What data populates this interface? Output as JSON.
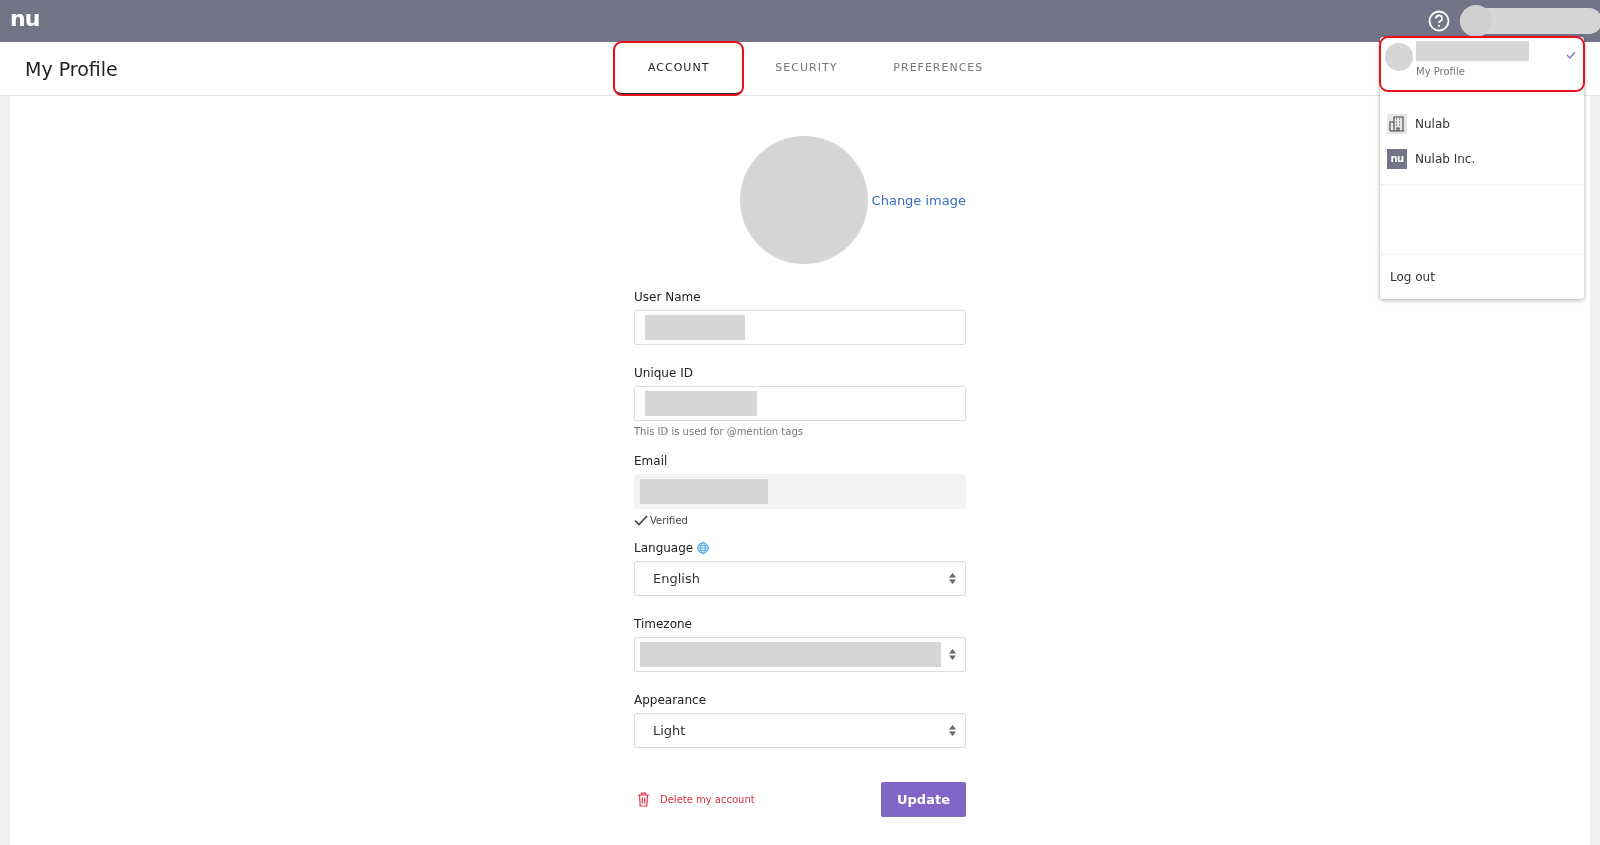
{
  "app_bar": {
    "logo_text": "nu"
  },
  "header": {
    "title": "My Profile"
  },
  "tabs": [
    {
      "label": "ACCOUNT",
      "selected": true,
      "highlighted": true
    },
    {
      "label": "SECURITY",
      "selected": false,
      "highlighted": false
    },
    {
      "label": "PREFERENCES",
      "selected": false,
      "highlighted": false
    }
  ],
  "profile_image": {
    "link": "Change image"
  },
  "fields": [
    {
      "kind": "text",
      "label": "User Name",
      "redacted": true
    },
    {
      "kind": "text",
      "label": "Unique ID",
      "redacted": true,
      "hint": "This ID is used for @mention tags"
    },
    {
      "kind": "readonly",
      "label": "Email",
      "redacted": true,
      "verified": true,
      "status": "Verified"
    },
    {
      "kind": "language_select",
      "label": "Language",
      "value": "English"
    },
    {
      "kind": "select",
      "label": "Timezone",
      "redacted": true
    },
    {
      "kind": "select",
      "label": "Appearance",
      "value": "Light"
    }
  ],
  "actions": {
    "delete": "Delete my account",
    "submit": "Update"
  },
  "account_menu": {
    "profile": {
      "subtitle": "My Profile",
      "checked": true,
      "highlighted": true
    },
    "organizations": [
      {
        "kind": "building",
        "name": "Nulab"
      },
      {
        "kind": "logo",
        "name": "Nulab Inc.",
        "logo_text": "nu"
      }
    ],
    "logout": "Log out"
  }
}
